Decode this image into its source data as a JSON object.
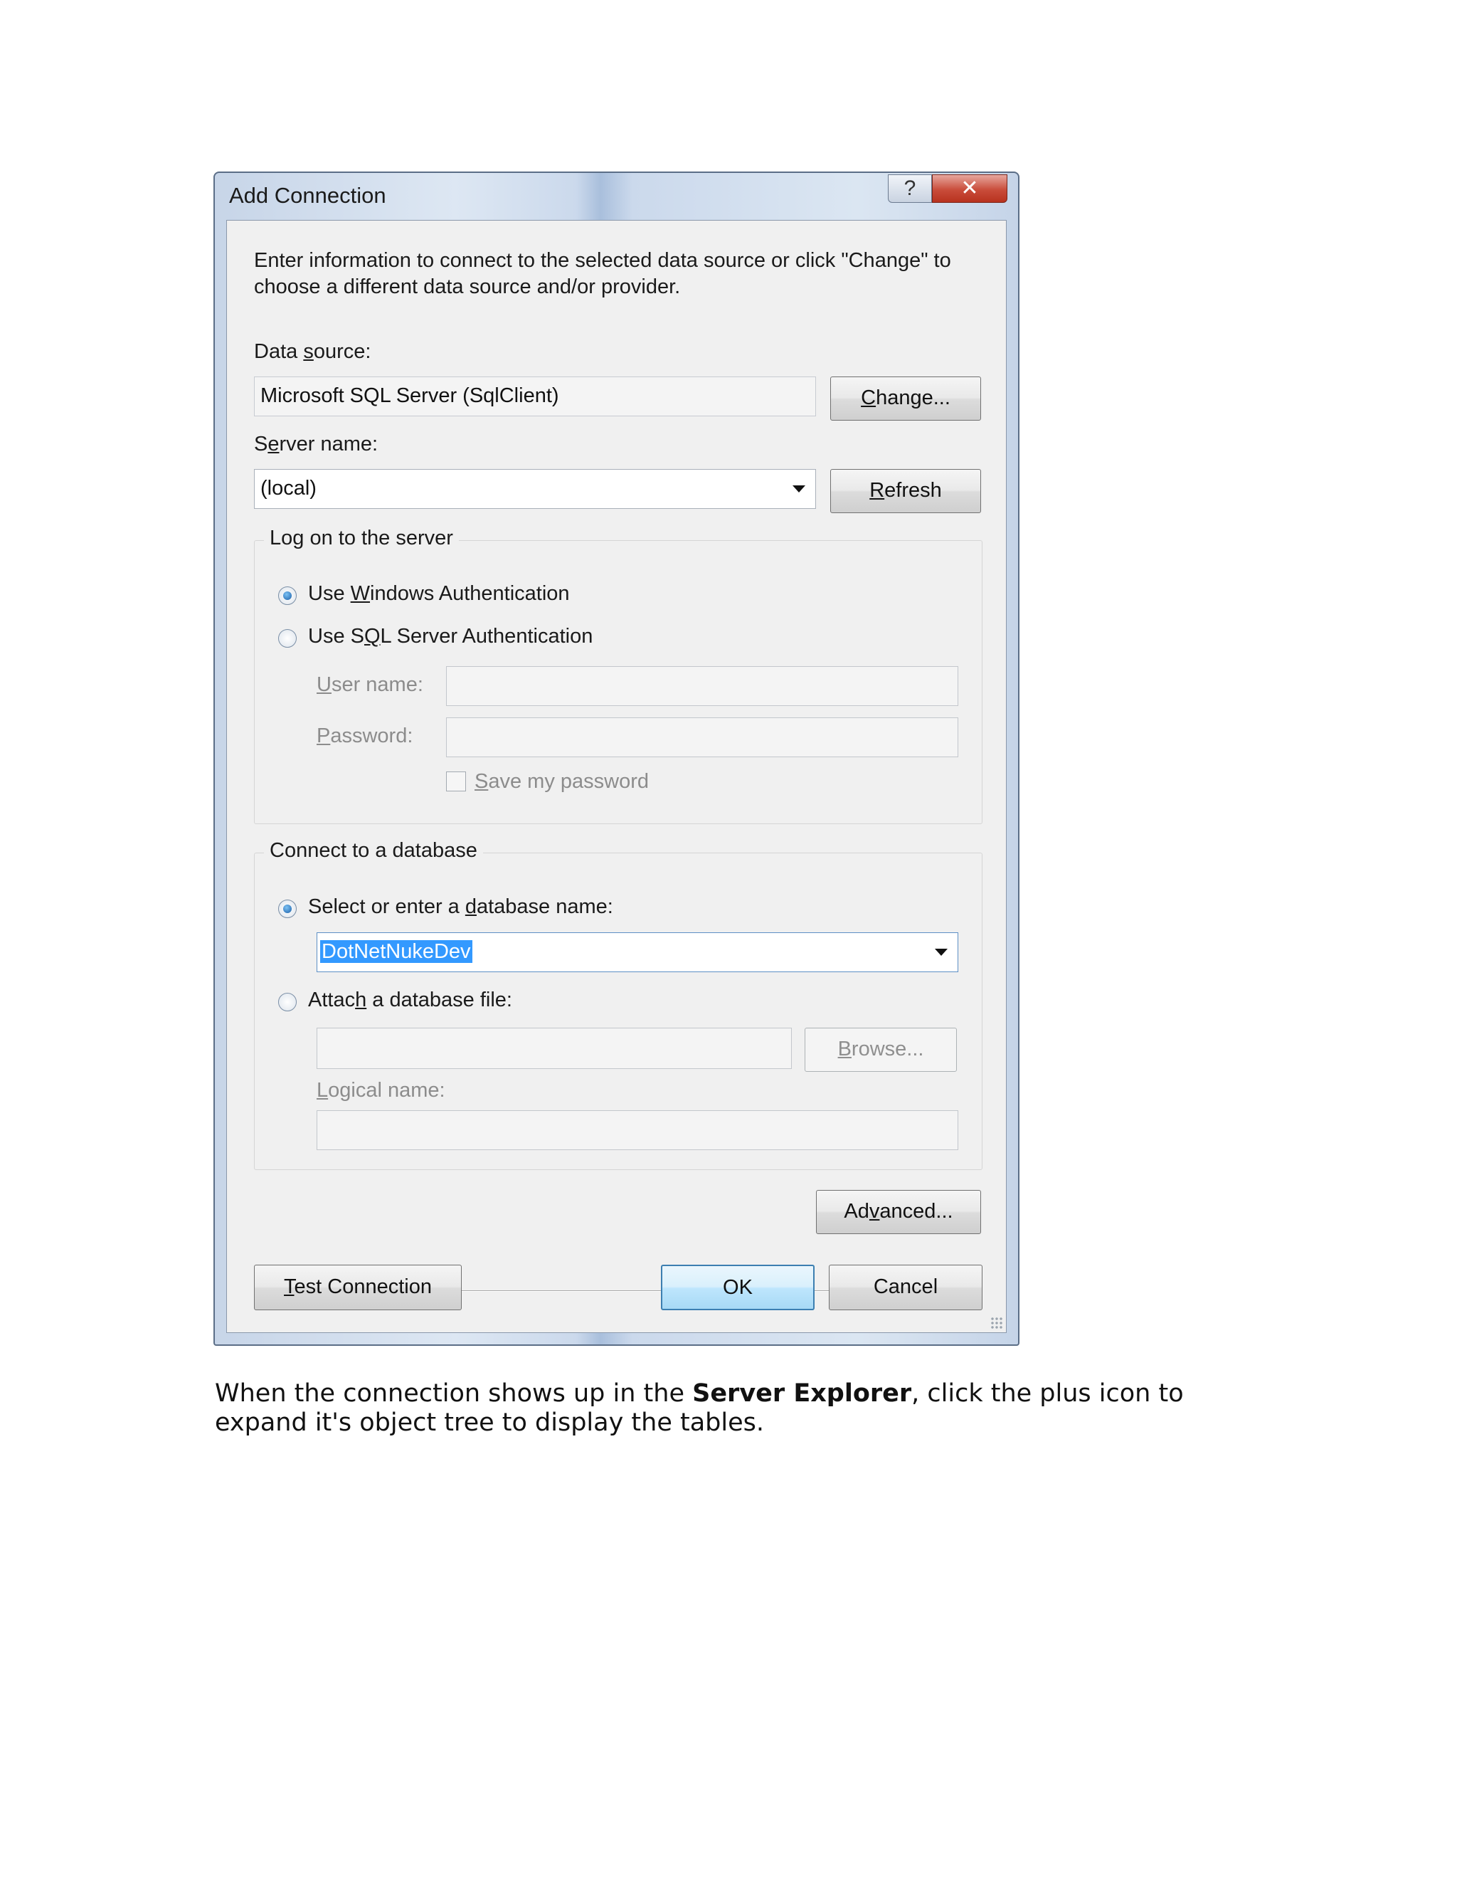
{
  "dialog": {
    "title": "Add Connection",
    "help_glyph": "?",
    "close_glyph": "✕",
    "intro_text": "Enter information to connect to the selected data source or click \"Change\" to choose a different data source and/or provider.",
    "data_source": {
      "label_pre": "Data ",
      "label_key": "s",
      "label_post": "ource:",
      "value": "Microsoft SQL Server (SqlClient)",
      "change_key": "C",
      "change_rest": "hange..."
    },
    "server_name": {
      "label_pre": "S",
      "label_key": "e",
      "label_post": "rver name:",
      "value": "(local)",
      "refresh_key": "R",
      "refresh_rest": "efresh"
    },
    "logon_group": {
      "legend": "Log on to the server",
      "windows_auth": {
        "pre": "Use ",
        "key": "W",
        "post": "indows Authentication",
        "selected": true
      },
      "sql_auth": {
        "pre": "Use S",
        "key": "Q",
        "post": "L Server Authentication",
        "selected": false
      },
      "user_name_label": {
        "key": "U",
        "rest": "ser name:"
      },
      "user_name_value": "",
      "password_label": {
        "key": "P",
        "rest": "assword:"
      },
      "password_value": "",
      "save_password": {
        "key": "S",
        "rest": "ave my password",
        "checked": false
      }
    },
    "database_group": {
      "legend": "Connect to a database",
      "select_db": {
        "pre": "Select or enter a ",
        "key": "d",
        "post": "atabase name:",
        "selected": true
      },
      "database_name": "DotNetNukeDev",
      "attach_file": {
        "pre": "Attac",
        "key": "h",
        "post": " a database file:",
        "selected": false
      },
      "file_path": "",
      "browse_key": "B",
      "browse_rest": "rowse...",
      "logical_name_label": {
        "key": "L",
        "rest": "ogical name:"
      },
      "logical_name_value": ""
    },
    "advanced": {
      "pre": "Ad",
      "key": "v",
      "post": "anced..."
    },
    "test_connection": {
      "key": "T",
      "rest": "est Connection"
    },
    "ok_label": "OK",
    "cancel_label": "Cancel"
  },
  "caption": {
    "before": "When the connection shows up in the ",
    "bold": "Server Explorer",
    "after": ", click the plus icon to expand it's object tree to display the tables."
  }
}
